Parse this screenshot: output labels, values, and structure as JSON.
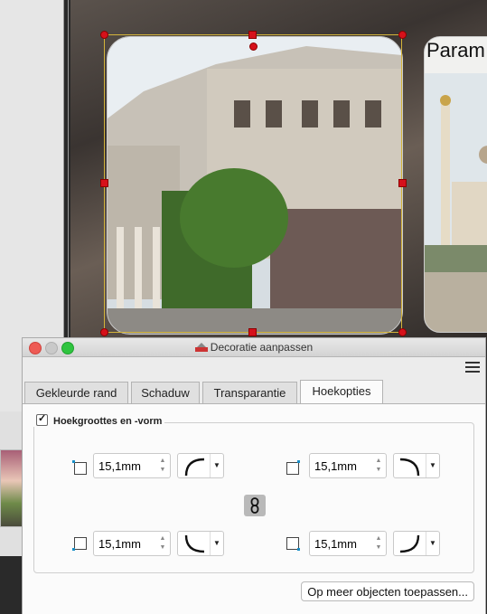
{
  "dialog": {
    "title": "Decoratie aanpassen",
    "tabs": [
      {
        "label": "Gekleurde rand",
        "active": false
      },
      {
        "label": "Schaduw",
        "active": false
      },
      {
        "label": "Transparantie",
        "active": false
      },
      {
        "label": "Hoekopties",
        "active": true
      }
    ],
    "group_title": "Hoekgroottes en -vorm",
    "group_checked": true,
    "corners": {
      "top_left": {
        "value": "15,1mm",
        "shape_icon": "concave-arc-top-left"
      },
      "top_right": {
        "value": "15,1mm",
        "shape_icon": "concave-arc-top-right"
      },
      "bottom_left": {
        "value": "15,1mm",
        "shape_icon": "concave-arc-bottom-left"
      },
      "bottom_right": {
        "value": "15,1mm",
        "shape_icon": "concave-arc-bottom-right"
      }
    },
    "apply_button": "Op meer objecten toepassen..."
  },
  "canvas": {
    "photo2_title": "Param"
  },
  "colors": {
    "selection_handle": "#d6111b",
    "selection_border": "#d4b43b",
    "corner_marker": "#1a8fc7"
  }
}
